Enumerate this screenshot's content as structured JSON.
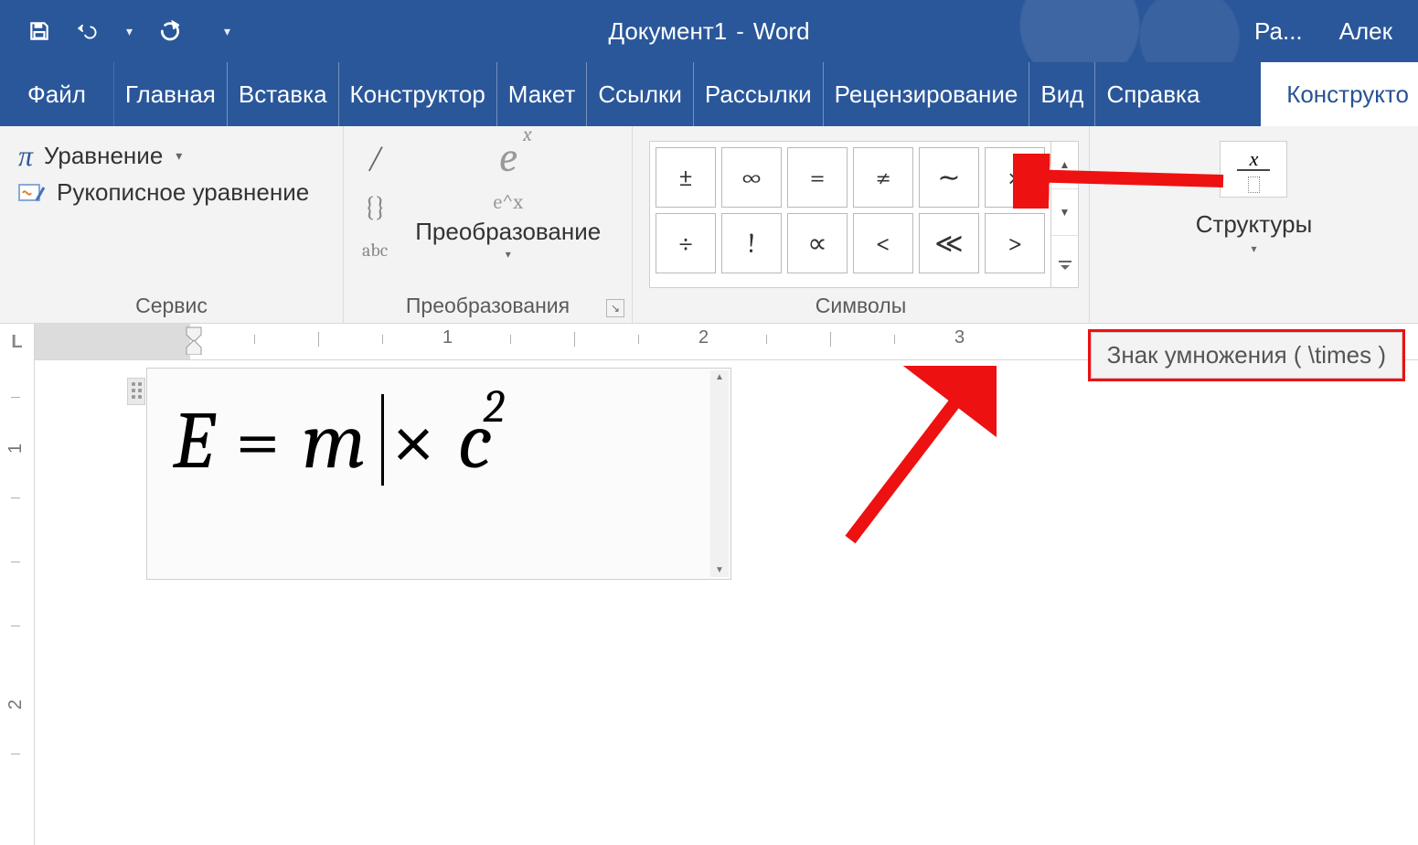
{
  "titlebar": {
    "doc_name": "Документ1",
    "app_name": "Word",
    "account_cut": "Алек",
    "tool_tab_cut": "Ра..."
  },
  "tabs": {
    "file": "Файл",
    "list": [
      "Главная",
      "Вставка",
      "Конструктор",
      "Макет",
      "Ссылки",
      "Рассылки",
      "Рецензирование",
      "Вид",
      "Справка"
    ],
    "active_right": "Конструкто"
  },
  "ribbon": {
    "tools": {
      "equation": "Уравнение",
      "ink_equation": "Рукописное уравнение",
      "label": "Сервис"
    },
    "conversions": {
      "caption": "Преобразование",
      "ex_small": "e^x",
      "abc": "abc",
      "label": "Преобразования"
    },
    "symbols": {
      "label": "Символы",
      "cells": [
        "±",
        "∞",
        "=",
        "≠",
        "∼",
        "×",
        "÷",
        "!",
        "∝",
        "<",
        "≪",
        ">"
      ]
    },
    "structures": {
      "caption": "Структуры",
      "x": "x"
    }
  },
  "ruler": {
    "marks": [
      "1",
      "2",
      "3"
    ]
  },
  "v_ruler": {
    "marks": [
      "1",
      "2"
    ]
  },
  "equation": {
    "E": "E",
    "eq": "=",
    "m": "m",
    "times": "×",
    "c": "c",
    "sq": "2"
  },
  "tooltip": {
    "text": "Знак умножения ( \\times )"
  }
}
